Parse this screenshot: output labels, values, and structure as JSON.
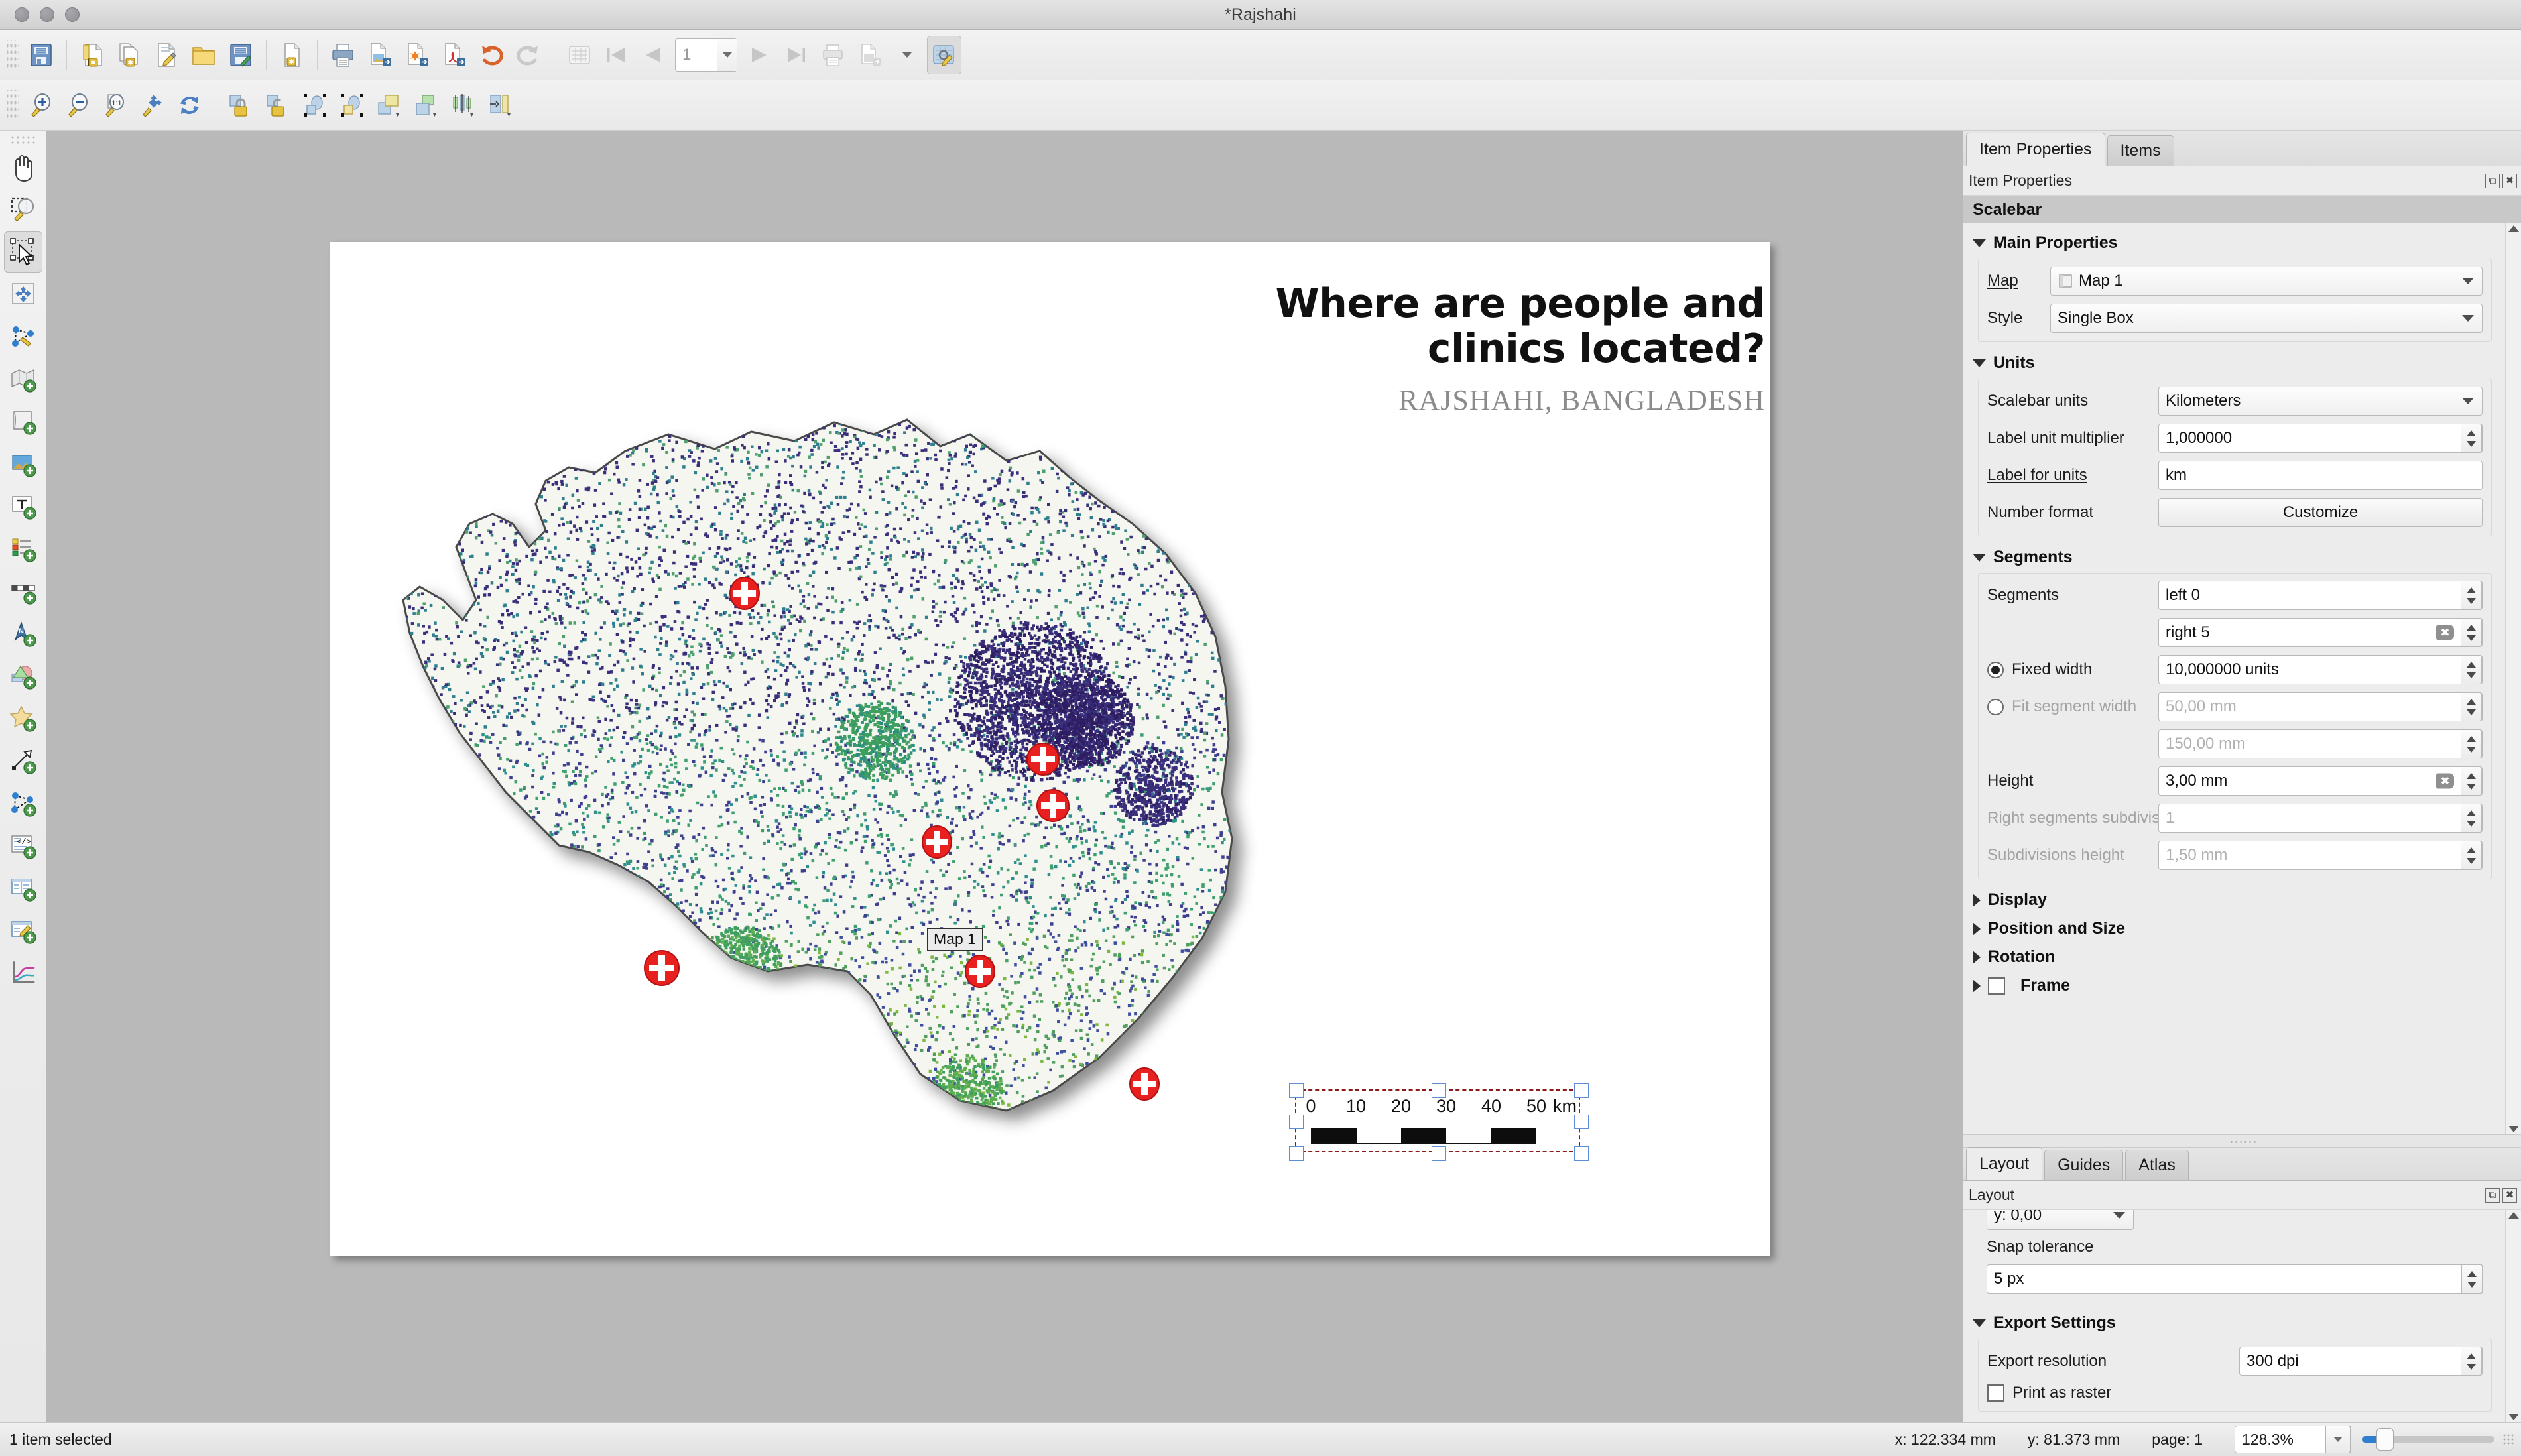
{
  "window": {
    "title": "*Rajshahi",
    "traffic_lights": [
      "close",
      "minimize",
      "zoom"
    ]
  },
  "toolbar_main": {
    "items": [
      {
        "name": "save-project",
        "icon": "save-icon"
      },
      {
        "name": "new-layout",
        "icon": "new-layout-icon"
      },
      {
        "name": "duplicate-layout",
        "icon": "duplicate-layout-icon"
      },
      {
        "name": "layout-manager",
        "icon": "layout-manager-icon"
      },
      {
        "name": "open-layout",
        "icon": "folder-open-icon"
      },
      {
        "name": "save-layout-as-template",
        "icon": "save-template-icon"
      },
      {
        "name": "add-items-from-template",
        "icon": "add-template-icon"
      },
      {
        "name": "print-layout",
        "icon": "printer-icon"
      },
      {
        "name": "export-as-image",
        "icon": "export-image-icon"
      },
      {
        "name": "export-as-svg",
        "icon": "export-svg-icon"
      },
      {
        "name": "export-as-pdf",
        "icon": "export-pdf-icon"
      },
      {
        "name": "undo",
        "icon": "undo-icon"
      },
      {
        "name": "redo",
        "icon": "redo-icon"
      },
      {
        "name": "atlas-settings",
        "icon": "atlas-icon"
      },
      {
        "name": "atlas-first-feature",
        "icon": "first-feature-icon"
      },
      {
        "name": "atlas-prev-feature",
        "icon": "prev-feature-icon"
      },
      {
        "name": "atlas-next-feature",
        "icon": "next-feature-icon"
      },
      {
        "name": "atlas-last-feature",
        "icon": "last-feature-icon"
      },
      {
        "name": "atlas-print",
        "icon": "printer-icon"
      },
      {
        "name": "atlas-export-image",
        "icon": "export-image-icon"
      },
      {
        "name": "atlas-export-dropdown",
        "icon": "chevron-down-icon"
      },
      {
        "name": "atlas-preview",
        "icon": "atlas-preview-icon"
      }
    ],
    "page_field_placeholder": "1"
  },
  "toolbar_nav": {
    "items": [
      {
        "name": "zoom-in",
        "icon": "zoom-in-icon"
      },
      {
        "name": "zoom-out",
        "icon": "zoom-out-icon"
      },
      {
        "name": "zoom-full",
        "icon": "zoom-100-icon"
      },
      {
        "name": "zoom-to-width",
        "icon": "zoom-width-icon"
      },
      {
        "name": "refresh-view",
        "icon": "refresh-icon"
      },
      {
        "name": "lock-selected-items",
        "icon": "lock-icon"
      },
      {
        "name": "unlock-all-items",
        "icon": "unlock-icon"
      },
      {
        "name": "group-items",
        "icon": "group-icon"
      },
      {
        "name": "ungroup-items",
        "icon": "ungroup-icon"
      },
      {
        "name": "raise-items",
        "icon": "raise-icon"
      },
      {
        "name": "lower-items",
        "icon": "lower-icon"
      },
      {
        "name": "align-items",
        "icon": "align-icon"
      },
      {
        "name": "distribute-items",
        "icon": "distribute-icon"
      }
    ]
  },
  "toolbox": {
    "items": [
      {
        "name": "pan-layout",
        "icon": "hand-icon",
        "selected": false
      },
      {
        "name": "zoom-tool",
        "icon": "zoom-rect-icon",
        "selected": false
      },
      {
        "name": "select-move-item",
        "icon": "select-arrow-icon",
        "selected": true
      },
      {
        "name": "move-item-content",
        "icon": "move-content-icon",
        "selected": false
      },
      {
        "name": "edit-nodes-item",
        "icon": "edit-nodes-icon",
        "selected": false
      },
      {
        "name": "add-map",
        "icon": "add-map-icon",
        "selected": false
      },
      {
        "name": "add-3d-map",
        "icon": "add-3d-map-icon",
        "selected": false
      },
      {
        "name": "add-picture",
        "icon": "add-picture-icon",
        "selected": false
      },
      {
        "name": "add-label",
        "icon": "add-label-icon",
        "selected": false
      },
      {
        "name": "add-legend",
        "icon": "add-legend-icon",
        "selected": false
      },
      {
        "name": "add-scalebar",
        "icon": "add-scalebar-icon",
        "selected": false
      },
      {
        "name": "add-north-arrow",
        "icon": "add-north-arrow-icon",
        "selected": false
      },
      {
        "name": "add-shape",
        "icon": "add-shape-icon",
        "selected": false
      },
      {
        "name": "add-marker",
        "icon": "add-star-icon",
        "selected": false
      },
      {
        "name": "add-arrow",
        "icon": "add-arrow-icon",
        "selected": false
      },
      {
        "name": "add-node-item",
        "icon": "add-node-icon",
        "selected": false
      },
      {
        "name": "add-html",
        "icon": "add-html-icon",
        "selected": false
      },
      {
        "name": "add-table",
        "icon": "add-table-icon",
        "selected": false
      },
      {
        "name": "add-manual-table",
        "icon": "add-manual-table-icon",
        "selected": false
      },
      {
        "name": "add-elevation-profile",
        "icon": "elevation-profile-icon",
        "selected": false
      }
    ]
  },
  "layout_page": {
    "title_line1": "Where are people and",
    "title_line2": "clinics located?",
    "subtitle": "RAJSHAHI, BANGLADESH",
    "map_item_label": "Map 1",
    "scalebar": {
      "ticks": [
        "0",
        "10",
        "20",
        "30",
        "40",
        "50"
      ],
      "unit_label": "km",
      "segments_pattern": [
        "black",
        "white",
        "black",
        "white",
        "black"
      ]
    }
  },
  "right_dock": {
    "tabs": [
      {
        "label": "Item Properties",
        "active": true
      },
      {
        "label": "Items",
        "active": false
      }
    ],
    "panel_title": "Item Properties",
    "item_type": "Scalebar",
    "sections": {
      "main_properties": {
        "title": "Main Properties",
        "expanded": true,
        "map_label": "Map",
        "map_value": "Map 1",
        "style_label": "Style",
        "style_value": "Single Box"
      },
      "units": {
        "title": "Units",
        "expanded": true,
        "scalebar_units_label": "Scalebar units",
        "scalebar_units_value": "Kilometers",
        "label_unit_multiplier_label": "Label unit multiplier",
        "label_unit_multiplier_value": "1,000000",
        "label_for_units_label": "Label for units",
        "label_for_units_value": "km",
        "number_format_label": "Number format",
        "number_format_button": "Customize"
      },
      "segments": {
        "title": "Segments",
        "expanded": true,
        "segments_label": "Segments",
        "segments_left_value": "left 0",
        "segments_right_value": "right 5",
        "fixed_width_label": "Fixed width",
        "fixed_width_selected": true,
        "fixed_width_value": "10,000000 units",
        "fit_segment_width_label": "Fit segment width",
        "fit_segment_width_selected": false,
        "fit_segment_width_value": "50,00 mm",
        "fit_segment_max_value": "150,00 mm",
        "height_label": "Height",
        "height_value": "3,00 mm",
        "right_subdivisions_label": "Right segments subdivisions",
        "right_subdivisions_value": "1",
        "subdivisions_height_label": "Subdivisions height",
        "subdivisions_height_value": "1,50 mm"
      },
      "collapsed": [
        {
          "title": "Display",
          "checkbox": false
        },
        {
          "title": "Position and Size",
          "checkbox": false
        },
        {
          "title": "Rotation",
          "checkbox": false
        },
        {
          "title": "Frame",
          "checkbox": true
        }
      ]
    }
  },
  "layout_dock": {
    "tabs": [
      {
        "label": "Layout",
        "active": true
      },
      {
        "label": "Guides",
        "active": false
      },
      {
        "label": "Atlas",
        "active": false
      }
    ],
    "panel_title": "Layout",
    "y_value": "y: 0,00",
    "snap_tolerance_label": "Snap tolerance",
    "snap_tolerance_value": "5 px",
    "export_settings": {
      "title": "Export Settings",
      "export_resolution_label": "Export resolution",
      "export_resolution_value": "300 dpi",
      "print_as_raster_label": "Print as raster",
      "print_as_raster_checked": false
    }
  },
  "statusbar": {
    "selection_text": "1 item selected",
    "x_coord": "x: 122.334 mm",
    "y_coord": "y: 81.373 mm",
    "page": "page: 1",
    "zoom_level": "128.3%"
  },
  "colors": {
    "accent_blue": "#2f7fd0",
    "selection_handle": "#5c8fd6",
    "item_selection_outline": "#8b1a1a",
    "clinic_marker_red": "#e8201f",
    "panel_bg": "#ececec",
    "canvas_bg": "#b9b9b9"
  }
}
